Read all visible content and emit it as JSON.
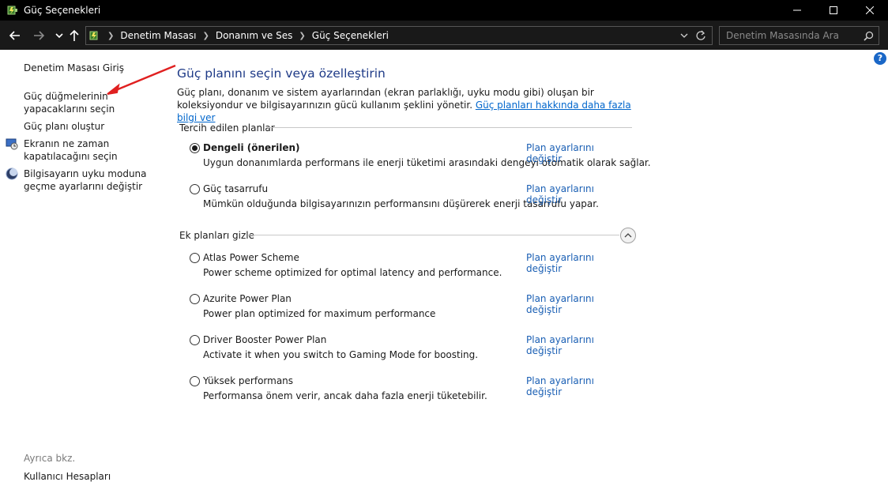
{
  "window": {
    "title": "Güç Seçenekleri"
  },
  "address": {
    "crumbs": [
      "Denetim Masası",
      "Donanım ve Ses",
      "Güç Seçenekleri"
    ],
    "search_placeholder": "Denetim Masasında Ara"
  },
  "sidebar": {
    "home": "Denetim Masası Giriş",
    "items": [
      "Güç düğmelerinin\nyapacaklarını seçin",
      "Güç planı oluştur",
      "Ekranın ne zaman\nkapatılacağını seçin",
      "Bilgisayarın uyku moduna\ngeçme ayarlarını değiştir"
    ],
    "see_also": "Ayrıca bkz.",
    "user_accounts": "Kullanıcı Hesapları"
  },
  "main": {
    "title": "Güç planını seçin veya özelleştirin",
    "description": "Güç planı, donanım ve sistem ayarlarından (ekran parlaklığı, uyku modu gibi) oluşan bir koleksiyondur ve bilgisayarınızın gücü kullanım şeklini yönetir. ",
    "learn_more": "Güç planları hakkında daha fazla bilgi ver",
    "preferred_header": "Tercih edilen planlar",
    "extra_header": "Ek planları gizle",
    "change_link": "Plan ayarlarını değiştir",
    "preferred_plans": [
      {
        "name": "Dengeli (önerilen)",
        "desc": "Uygun donanımlarda performans ile enerji tüketimi arasındaki dengeyi otomatik olarak sağlar.",
        "selected": true
      },
      {
        "name": "Güç tasarrufu",
        "desc": "Mümkün olduğunda bilgisayarınızın performansını düşürerek enerji tasarrufu yapar.",
        "selected": false
      }
    ],
    "extra_plans": [
      {
        "name": "Atlas Power Scheme",
        "desc": "Power scheme optimized for optimal latency and performance.",
        "selected": false
      },
      {
        "name": "Azurite Power Plan",
        "desc": "Power plan optimized for maximum performance",
        "selected": false
      },
      {
        "name": "Driver Booster Power Plan",
        "desc": "Activate it when you switch to Gaming Mode for boosting.",
        "selected": false
      },
      {
        "name": "Yüksek performans",
        "desc": "Performansa önem verir, ancak daha fazla enerji tüketebilir.",
        "selected": false
      }
    ]
  },
  "colors": {
    "accent": "#1a5fb4",
    "title": "#1e3a87",
    "annotation_arrow": "#e02020"
  }
}
